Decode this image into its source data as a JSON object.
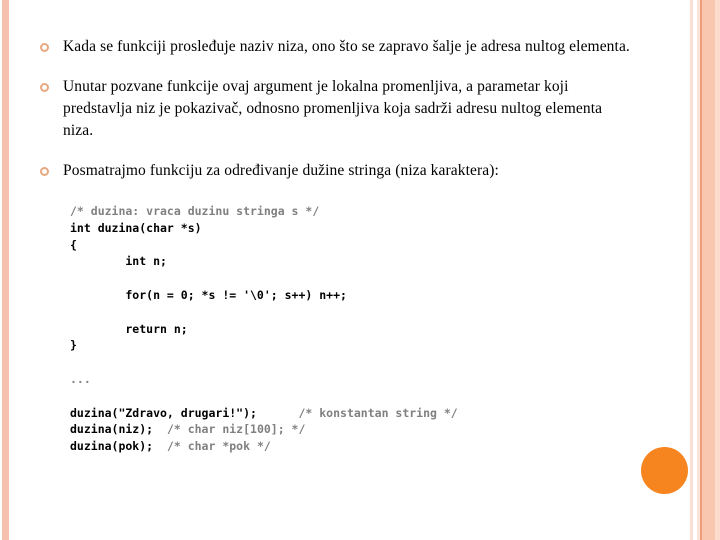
{
  "slide": {
    "background_color": "#ffffff",
    "accent_colors": {
      "bar_salmon": "#f6c1ac",
      "bar_light": "#fae0d4",
      "bar_accent_line": "#ef9f78",
      "bullet_ring": "#e8a97e",
      "orange_dot": "#f6851f",
      "comment_gray": "#808080",
      "text_black": "#000000"
    },
    "bullets": [
      {
        "marker": "hollow-circle-bullet",
        "text": "Kada se funkciji prosleđuje naziv niza, ono što se zapravo šalje je adresa nultog elementa."
      },
      {
        "marker": "hollow-circle-bullet",
        "text": "Unutar pozvane funkcije ovaj argument je lokalna promenljiva, a parametar koji predstavlja niz je pokazivač, odnosno promenljiva koja sadrži adresu nultog elementa niza."
      },
      {
        "marker": "hollow-circle-bullet",
        "text": "Posmatrajmo funkciju za određivanje dužine stringa (niza karaktera):"
      }
    ],
    "code": {
      "lines": [
        {
          "segments": [
            {
              "kind": "comment",
              "text": "/* duzina: vraca duzinu stringa s */"
            }
          ]
        },
        {
          "segments": [
            {
              "kind": "code",
              "text": "int duzina(char *s)"
            }
          ]
        },
        {
          "segments": [
            {
              "kind": "code",
              "text": "{"
            }
          ]
        },
        {
          "segments": [
            {
              "kind": "code",
              "text": "        int n;"
            }
          ]
        },
        {
          "segments": [
            {
              "kind": "code",
              "text": ""
            }
          ]
        },
        {
          "segments": [
            {
              "kind": "code",
              "text": "        for(n = 0; *s != '\\0'; s++) n++;"
            }
          ]
        },
        {
          "segments": [
            {
              "kind": "code",
              "text": ""
            }
          ]
        },
        {
          "segments": [
            {
              "kind": "code",
              "text": "        return n;"
            }
          ]
        },
        {
          "segments": [
            {
              "kind": "code",
              "text": "}"
            }
          ]
        },
        {
          "segments": [
            {
              "kind": "code",
              "text": ""
            }
          ]
        },
        {
          "segments": [
            {
              "kind": "comment",
              "text": "..."
            }
          ]
        },
        {
          "segments": [
            {
              "kind": "code",
              "text": ""
            }
          ]
        },
        {
          "segments": [
            {
              "kind": "code",
              "text": "duzina(\"Zdravo, drugari!\");      "
            },
            {
              "kind": "comment",
              "text": "/* konstantan string */"
            }
          ]
        },
        {
          "segments": [
            {
              "kind": "code",
              "text": "duzina(niz);  "
            },
            {
              "kind": "comment",
              "text": "/* char niz[100]; */"
            }
          ]
        },
        {
          "segments": [
            {
              "kind": "code",
              "text": "duzina(pok);  "
            },
            {
              "kind": "comment",
              "text": "/* char *pok */"
            }
          ]
        }
      ]
    },
    "decorations": {
      "orange_dot_label": "orange-circle-decoration"
    }
  }
}
